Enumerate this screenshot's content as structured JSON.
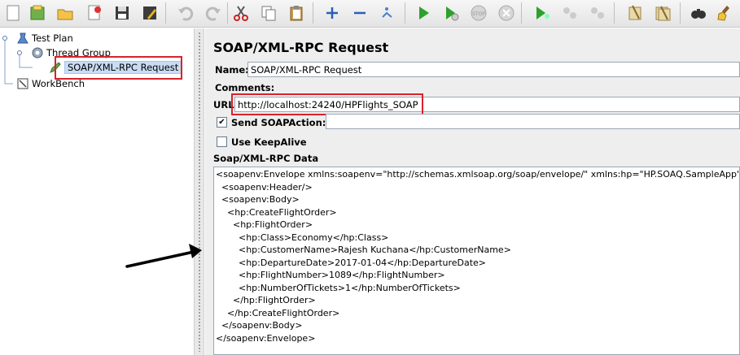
{
  "toolbar": {
    "buttons": [
      "new-icon",
      "templates-icon",
      "open-icon",
      "close-icon",
      "save-icon",
      "save-as-icon",
      "undo-icon",
      "redo-icon",
      "cut-icon",
      "copy-icon",
      "paste-icon",
      "expand-icon",
      "collapse-icon",
      "toggle-icon",
      "start-icon",
      "start-no-pause-icon",
      "stop-icon",
      "shutdown-icon",
      "remote-start-icon",
      "remote-stop-icon",
      "remote-shutdown-icon",
      "clear-icon",
      "clear-all-icon",
      "search-icon",
      "reset-search-icon"
    ]
  },
  "tree": {
    "items": [
      {
        "label": "Test Plan"
      },
      {
        "label": "Thread Group"
      },
      {
        "label": "SOAP/XML-RPC Request"
      },
      {
        "label": "WorkBench"
      }
    ]
  },
  "panel": {
    "title": "SOAP/XML-RPC Request",
    "name_label": "Name:",
    "name_value": "SOAP/XML-RPC Request",
    "comments_label": "Comments:",
    "url_label": "URL",
    "url_value": "http://localhost:24240/HPFlights_SOAP",
    "send_soapaction_label": "Send SOAPAction:",
    "send_soapaction_checked": "✔",
    "use_keepalive_label": "Use KeepAlive",
    "data_label": "Soap/XML-RPC Data",
    "xml_lines": [
      "<soapenv:Envelope xmlns:soapenv=\"http://schemas.xmlsoap.org/soap/envelope/\" xmlns:hp=\"HP.SOAQ.SampleApp\">",
      "  <soapenv:Header/>",
      "  <soapenv:Body>",
      "    <hp:CreateFlightOrder>",
      "      <hp:FlightOrder>",
      "        <hp:Class>Economy</hp:Class>",
      "        <hp:CustomerName>Rajesh Kuchana</hp:CustomerName>",
      "        <hp:DepartureDate>2017-01-04</hp:DepartureDate>",
      "        <hp:FlightNumber>1089</hp:FlightNumber>",
      "        <hp:NumberOfTickets>1</hp:NumberOfTickets>",
      "      </hp:FlightOrder>",
      "    </hp:CreateFlightOrder>",
      "  </soapenv:Body>",
      "</soapenv:Envelope>"
    ]
  },
  "colors": {
    "highlight_red": "#d8232a",
    "selection_blue": "#c9dcf4"
  }
}
